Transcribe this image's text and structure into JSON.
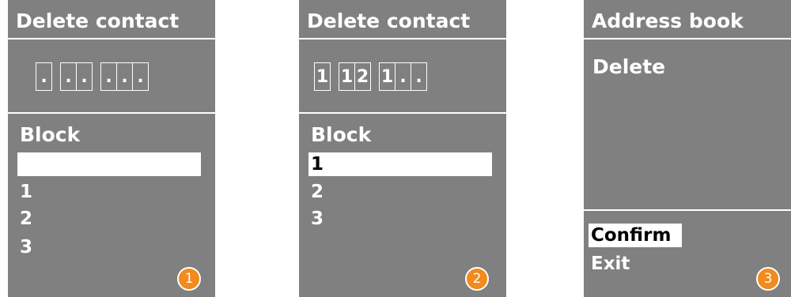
{
  "screens": [
    {
      "title": "Delete contact",
      "digit_groups": [
        [
          "."
        ],
        [
          ".",
          "."
        ],
        [
          ".",
          ".",
          "."
        ]
      ],
      "section": "Block",
      "items": [
        "",
        "1",
        "2",
        "3"
      ],
      "selected_index": 0,
      "step": "1"
    },
    {
      "title": "Delete contact",
      "digit_groups": [
        [
          "1"
        ],
        [
          "1",
          "2"
        ],
        [
          "1",
          ".",
          "."
        ]
      ],
      "section": "Block",
      "items": [
        "1",
        "2",
        "3"
      ],
      "selected_index": 0,
      "step": "2"
    },
    {
      "title": "Address book",
      "subtitle": "Delete",
      "options": [
        "Confirm",
        "Exit"
      ],
      "selected_index": 0,
      "step": "3"
    }
  ],
  "colors": {
    "screen_bg": "#808080",
    "badge": "#f28a1d",
    "highlight": "#ffffff"
  }
}
